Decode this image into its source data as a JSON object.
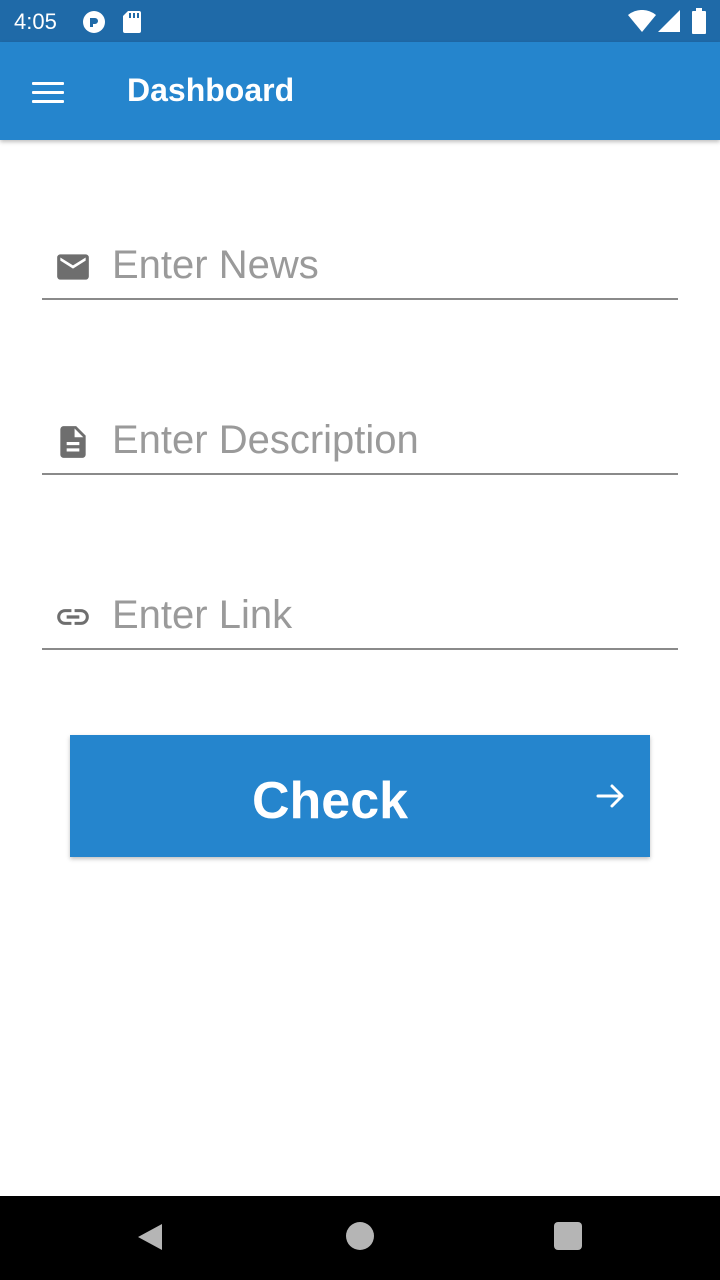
{
  "status_bar": {
    "time": "4:05",
    "icons": [
      "pocket-casts-icon",
      "sd-card-icon",
      "wifi-icon",
      "cell-signal-icon",
      "battery-icon"
    ]
  },
  "app_bar": {
    "title": "Dashboard",
    "menu_icon": "hamburger-menu-icon",
    "color": "#2585cd"
  },
  "form": {
    "news": {
      "placeholder": "Enter News",
      "value": "",
      "icon": "email-icon"
    },
    "description": {
      "placeholder": "Enter Description",
      "value": "",
      "icon": "document-icon"
    },
    "link": {
      "placeholder": "Enter Link",
      "value": "",
      "icon": "link-icon"
    }
  },
  "check_button": {
    "label": "Check",
    "icon": "arrow-right-icon",
    "color": "#2585cd"
  },
  "nav_bar": {
    "buttons": [
      "back-icon",
      "home-icon",
      "recents-icon"
    ]
  }
}
